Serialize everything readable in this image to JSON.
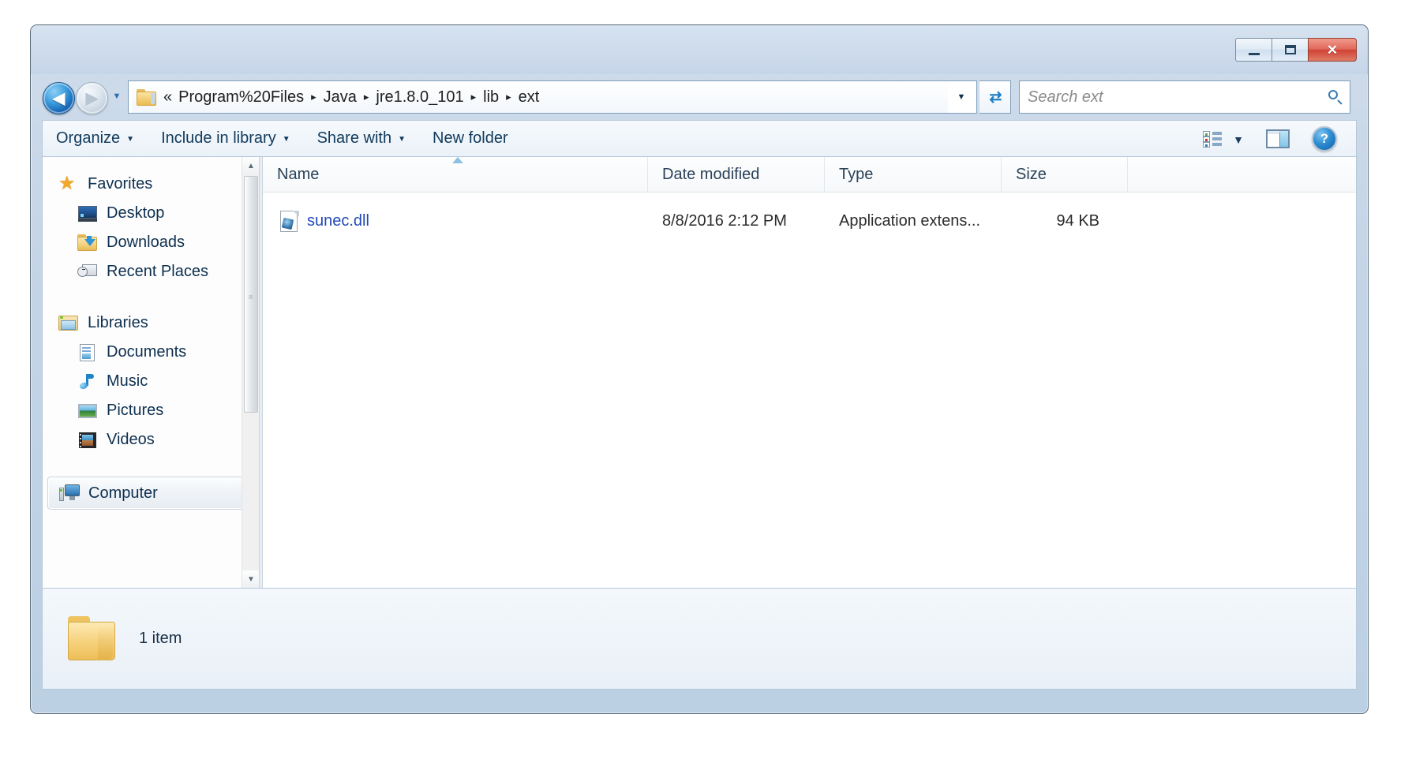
{
  "window": {
    "controls": {
      "minimize_label": "Minimize",
      "maximize_label": "Maximize",
      "close_label": "Close",
      "minimize_glyph": "",
      "maximize_glyph": "",
      "close_glyph": "✕"
    }
  },
  "navigation": {
    "back_label": "Back",
    "back_glyph": "◀",
    "forward_label": "Forward",
    "forward_glyph": "▶",
    "recent_pages_glyph": "▼",
    "address_dropdown_glyph": "▼",
    "refresh_glyph": "↻",
    "breadcrumb": {
      "overflow": "«",
      "separator": "▸",
      "crumbs": [
        "Program%20Files",
        "Java",
        "jre1.8.0_101",
        "lib",
        "ext"
      ]
    },
    "search": {
      "placeholder": "Search ext",
      "value": ""
    }
  },
  "command_bar": {
    "items": [
      {
        "label": "Organize",
        "has_caret": true,
        "caret": "▼"
      },
      {
        "label": "Include in library",
        "has_caret": true,
        "caret": "▼"
      },
      {
        "label": "Share with",
        "has_caret": true,
        "caret": "▼"
      },
      {
        "label": "New folder",
        "has_caret": false,
        "caret": ""
      }
    ],
    "view_options_label": "Change your view",
    "view_caret": "▼",
    "preview_pane_label": "Show the preview pane",
    "help_label": "Get help",
    "help_glyph": "?"
  },
  "sidebar": {
    "groups": [
      {
        "header": {
          "label": "Favorites",
          "icon": "star-icon"
        },
        "items": [
          {
            "label": "Desktop",
            "icon": "desktop-icon"
          },
          {
            "label": "Downloads",
            "icon": "downloads-folder-icon"
          },
          {
            "label": "Recent Places",
            "icon": "recent-places-icon"
          }
        ]
      },
      {
        "header": {
          "label": "Libraries",
          "icon": "libraries-icon"
        },
        "items": [
          {
            "label": "Documents",
            "icon": "documents-icon"
          },
          {
            "label": "Music",
            "icon": "music-icon"
          },
          {
            "label": "Pictures",
            "icon": "pictures-icon"
          },
          {
            "label": "Videos",
            "icon": "videos-icon"
          }
        ]
      }
    ],
    "selected": {
      "label": "Computer",
      "icon": "computer-icon"
    },
    "scroll_up_glyph": "▲",
    "scroll_down_glyph": "▼",
    "scroll_grip_glyph": "≡"
  },
  "file_list": {
    "columns": [
      {
        "key": "name",
        "label": "Name",
        "sorted": true,
        "sort_direction": "ascending"
      },
      {
        "key": "date",
        "label": "Date modified",
        "sorted": false,
        "sort_direction": ""
      },
      {
        "key": "type",
        "label": "Type",
        "sorted": false,
        "sort_direction": ""
      },
      {
        "key": "size",
        "label": "Size",
        "sorted": false,
        "sort_direction": ""
      }
    ],
    "rows": [
      {
        "name": "sunec.dll",
        "date": "8/8/2016 2:12 PM",
        "type": "Application extens...",
        "size": "94 KB",
        "icon": "dll-file-icon"
      }
    ]
  },
  "status_bar": {
    "item_count": "1 item",
    "folder_icon": "folder-icon"
  },
  "colors": {
    "link_blue": "#1f49b6",
    "chrome_blue": "#c6d6e9",
    "accent": "#1464b4",
    "close_red": "#cf4334"
  }
}
